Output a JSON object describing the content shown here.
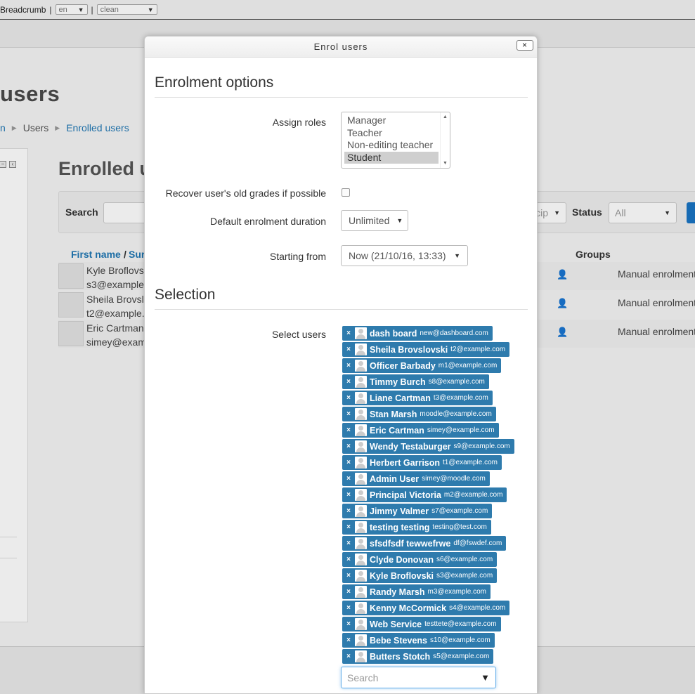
{
  "topbar": {
    "breadcrumb": "Breadcrumb",
    "separator": "|",
    "lang": "en",
    "theme": "clean"
  },
  "page": {
    "heading": "users",
    "breadcrumbs": [
      "n",
      "Users",
      "Enrolled users"
    ],
    "section_title": "Enrolled u",
    "filter": {
      "search_label": "Search",
      "role_partial": "cip",
      "status_label": "Status",
      "status_value": "All"
    },
    "columns": {
      "first_name": "First name",
      "slash": "/",
      "surname": "Sur",
      "groups": "Groups"
    },
    "rows": [
      {
        "name": "Kyle Broflovs",
        "email": "s3@example",
        "method": "Manual enrolment"
      },
      {
        "name": "Sheila Brovsl",
        "email": "t2@example.",
        "method": "Manual enrolment"
      },
      {
        "name": "Eric Cartman",
        "email": "simey@exam",
        "method": "Manual enrolment"
      }
    ]
  },
  "dialog": {
    "title": "Enrol users",
    "close": "×",
    "enrolment_legend": "Enrolment options",
    "assign_roles_label": "Assign roles",
    "roles": [
      "Manager",
      "Teacher",
      "Non-editing teacher",
      "Student"
    ],
    "selected_role": "Student",
    "recover_label": "Recover user's old grades if possible",
    "duration_label": "Default enrolment duration",
    "duration_value": "Unlimited",
    "starting_label": "Starting from",
    "starting_value": "Now (21/10/16, 13:33)",
    "selection_legend": "Selection",
    "select_users_label": "Select users",
    "remove_glyph": "×",
    "selected_users": [
      {
        "name": "dash board",
        "email": "new@dashboard.com"
      },
      {
        "name": "Sheila Brovslovski",
        "email": "t2@example.com"
      },
      {
        "name": "Officer Barbady",
        "email": "m1@example.com"
      },
      {
        "name": "Timmy Burch",
        "email": "s8@example.com"
      },
      {
        "name": "Liane Cartman",
        "email": "t3@example.com"
      },
      {
        "name": "Stan Marsh",
        "email": "moodle@example.com"
      },
      {
        "name": "Eric Cartman",
        "email": "simey@example.com"
      },
      {
        "name": "Wendy Testaburger",
        "email": "s9@example.com"
      },
      {
        "name": "Herbert Garrison",
        "email": "t1@example.com"
      },
      {
        "name": "Admin User",
        "email": "simey@moodle.com"
      },
      {
        "name": "Principal Victoria",
        "email": "m2@example.com"
      },
      {
        "name": "Jimmy Valmer",
        "email": "s7@example.com"
      },
      {
        "name": "testing testing",
        "email": "testing@test.com"
      },
      {
        "name": "sfsdfsdf tewwefrwe",
        "email": "df@fswdef.com"
      },
      {
        "name": "Clyde Donovan",
        "email": "s6@example.com"
      },
      {
        "name": "Kyle Broflovski",
        "email": "s3@example.com"
      },
      {
        "name": "Randy Marsh",
        "email": "m3@example.com"
      },
      {
        "name": "Kenny McCormick",
        "email": "s4@example.com"
      },
      {
        "name": "Web Service",
        "email": "testtete@example.com"
      },
      {
        "name": "Bebe Stevens",
        "email": "s10@example.com"
      },
      {
        "name": "Butters Stotch",
        "email": "s5@example.com"
      }
    ],
    "search_placeholder": "Search"
  }
}
